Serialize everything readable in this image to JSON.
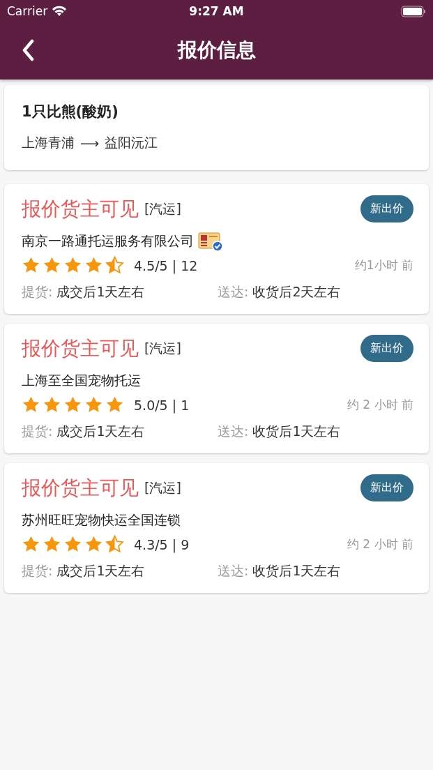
{
  "status_bar": {
    "carrier": "Carrier",
    "time": "9:27 AM"
  },
  "nav": {
    "title": "报价信息"
  },
  "order": {
    "title": "1只比熊(酸奶)",
    "from": "上海青浦",
    "arrow": "⟶",
    "to": "益阳沅江"
  },
  "quotes": [
    {
      "price": "报价货主可见",
      "mode": "[汽运]",
      "button": "新出价",
      "company": "南京一路通托运服务有限公司",
      "verified": true,
      "stars": 4.5,
      "rating": "4.5/5 | 12",
      "time": "约1小时 前",
      "pickup_label": "提货:",
      "pickup": "成交后1天左右",
      "delivery_label": "送达:",
      "delivery": "收货后2天左右"
    },
    {
      "price": "报价货主可见",
      "mode": "[汽运]",
      "button": "新出价",
      "company": "上海至全国宠物托运",
      "verified": false,
      "stars": 5,
      "rating": "5.0/5 | 1",
      "time": "约 2 小时 前",
      "pickup_label": "提货:",
      "pickup": "成交后1天左右",
      "delivery_label": "送达:",
      "delivery": "收货后1天左右"
    },
    {
      "price": "报价货主可见",
      "mode": "[汽运]",
      "button": "新出价",
      "company": "苏州旺旺宠物快运全国连锁",
      "verified": false,
      "stars": 4.5,
      "rating": "4.3/5 | 9",
      "time": "约 2 小时 前",
      "pickup_label": "提货:",
      "pickup": "成交后1天左右",
      "delivery_label": "送达:",
      "delivery": "收货后1天左右"
    }
  ]
}
